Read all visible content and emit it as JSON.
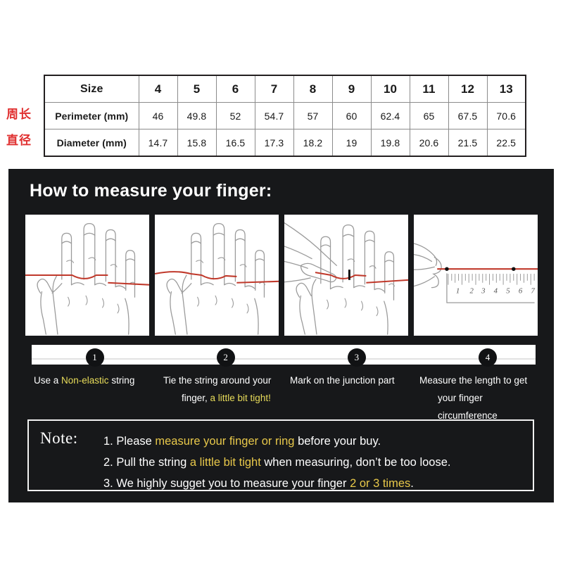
{
  "size_table": {
    "row_labels": [
      "Size",
      "Perimeter (mm)",
      "Diameter (mm)"
    ],
    "sizes": [
      "4",
      "5",
      "6",
      "7",
      "8",
      "9",
      "10",
      "11",
      "12",
      "13"
    ],
    "perimeter_mm": [
      "46",
      "49.8",
      "52",
      "54.7",
      "57",
      "60",
      "62.4",
      "65",
      "67.5",
      "70.6"
    ],
    "diameter_mm": [
      "14.7",
      "15.8",
      "16.5",
      "17.3",
      "18.2",
      "19",
      "19.8",
      "20.6",
      "21.5",
      "22.5"
    ],
    "annotations": {
      "perimeter_cn": "周长",
      "diameter_cn": "直径",
      "annotation_color": "#e03030"
    }
  },
  "panel": {
    "title": "How to measure your finger:",
    "background_color": "#17181a",
    "highlight_color": "#e8dc5a",
    "note_highlight_color": "#e8c84a",
    "illustrations": [
      {
        "name": "hand-with-string",
        "ruler_ticks": []
      },
      {
        "name": "hand-string-tied",
        "ruler_ticks": []
      },
      {
        "name": "hand-marking-junction",
        "ruler_ticks": []
      },
      {
        "name": "string-measured-on-ruler",
        "ruler_ticks": [
          "1",
          "2",
          "3",
          "4",
          "5",
          "6",
          "7"
        ]
      }
    ],
    "steps": [
      {
        "number": "1",
        "line1_pre": "Use a ",
        "line1_hl": "Non-elastic",
        "line1_post": " string",
        "line2_pre": "",
        "line2_hl": "",
        "line2_post": ""
      },
      {
        "number": "2",
        "line1_pre": "Tie the string around your",
        "line1_hl": "",
        "line1_post": "",
        "line2_pre": "finger, ",
        "line2_hl": "a little bit tight!",
        "line2_post": ""
      },
      {
        "number": "3",
        "line1_pre": "Mark on the junction part",
        "line1_hl": "",
        "line1_post": "",
        "line2_pre": "",
        "line2_hl": "",
        "line2_post": ""
      },
      {
        "number": "4",
        "line1_pre": "Measure the length to get",
        "line1_hl": "",
        "line1_post": "",
        "line2_pre": "your finger circumference",
        "line2_hl": "",
        "line2_post": ""
      }
    ],
    "note": {
      "label": "Note:",
      "lines": [
        {
          "pre": "1. Please ",
          "hl": "measure your finger or ring",
          "post": " before your buy."
        },
        {
          "pre": "2. Pull the string ",
          "hl": "a little bit tight",
          "post": " when measuring, don’t be too loose."
        },
        {
          "pre": "3. We highly sugget you to measure your finger ",
          "hl": "2 or 3 times",
          "post": "."
        }
      ]
    }
  }
}
